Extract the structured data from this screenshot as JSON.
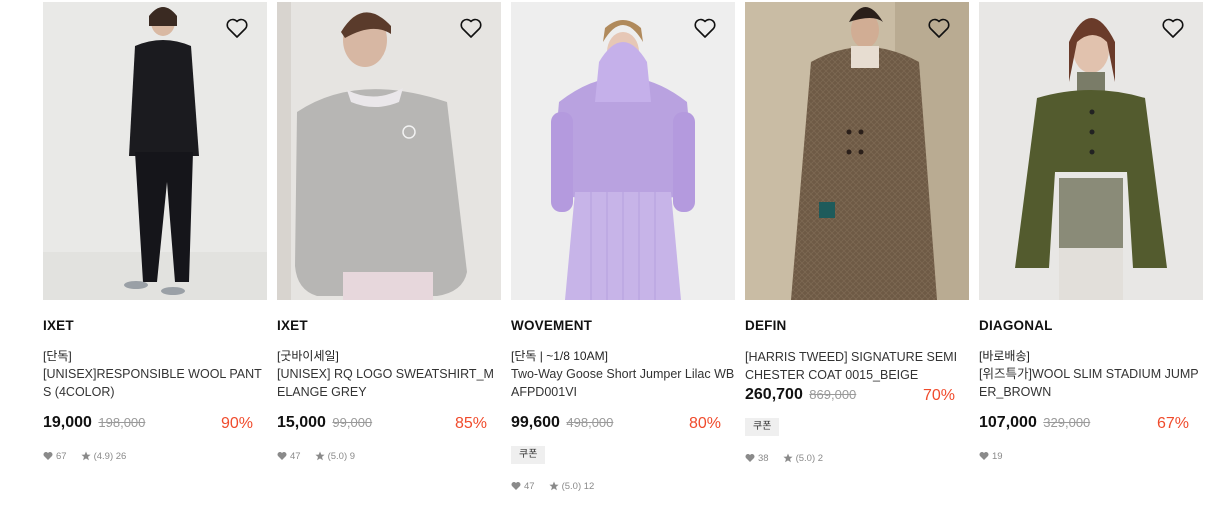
{
  "products": [
    {
      "brand": "IXET",
      "tag": "[단독]",
      "name": "[UNISEX]RESPONSIBLE WOOL PANTS (4COLOR)",
      "price": "19,000",
      "original_price": "198,000",
      "discount": "90%",
      "likes": "67",
      "rating": "(4.9) 26",
      "coupon": ""
    },
    {
      "brand": "IXET",
      "tag": "[굿바이세일]",
      "name": "[UNISEX] RQ LOGO SWEATSHIRT_MELANGE GREY",
      "price": "15,000",
      "original_price": "99,000",
      "discount": "85%",
      "likes": "47",
      "rating": "(5.0) 9",
      "coupon": ""
    },
    {
      "brand": "WOVEMENT",
      "tag": "[단독 | ~1/8 10AM]",
      "name": "Two-Way Goose Short Jumper Lilac WBAFPD001VI",
      "price": "99,600",
      "original_price": "498,000",
      "discount": "80%",
      "likes": "47",
      "rating": "(5.0) 12",
      "coupon": "쿠폰"
    },
    {
      "brand": "DEFIN",
      "tag": "",
      "name": "[HARRIS TWEED] SIGNATURE SEMI CHESTER COAT 0015_BEIGE",
      "price": "260,700",
      "original_price": "869,000",
      "discount": "70%",
      "likes": "38",
      "rating": "(5.0) 2",
      "coupon": "쿠폰"
    },
    {
      "brand": "DIAGONAL",
      "tag": "[바로배송]",
      "name": "[위즈특가]WOOL SLIM STADIUM JUMPER_BROWN",
      "price": "107,000",
      "original_price": "329,000",
      "discount": "67%",
      "likes": "19",
      "rating": "",
      "coupon": ""
    }
  ],
  "icons": {
    "wishlist": "heart-outline-icon",
    "likes": "heart-filled-icon",
    "rating": "star-icon"
  },
  "colors": {
    "discount": "#f04b2c",
    "coupon_bg": "#efefef",
    "meta": "#8a8a8a"
  }
}
